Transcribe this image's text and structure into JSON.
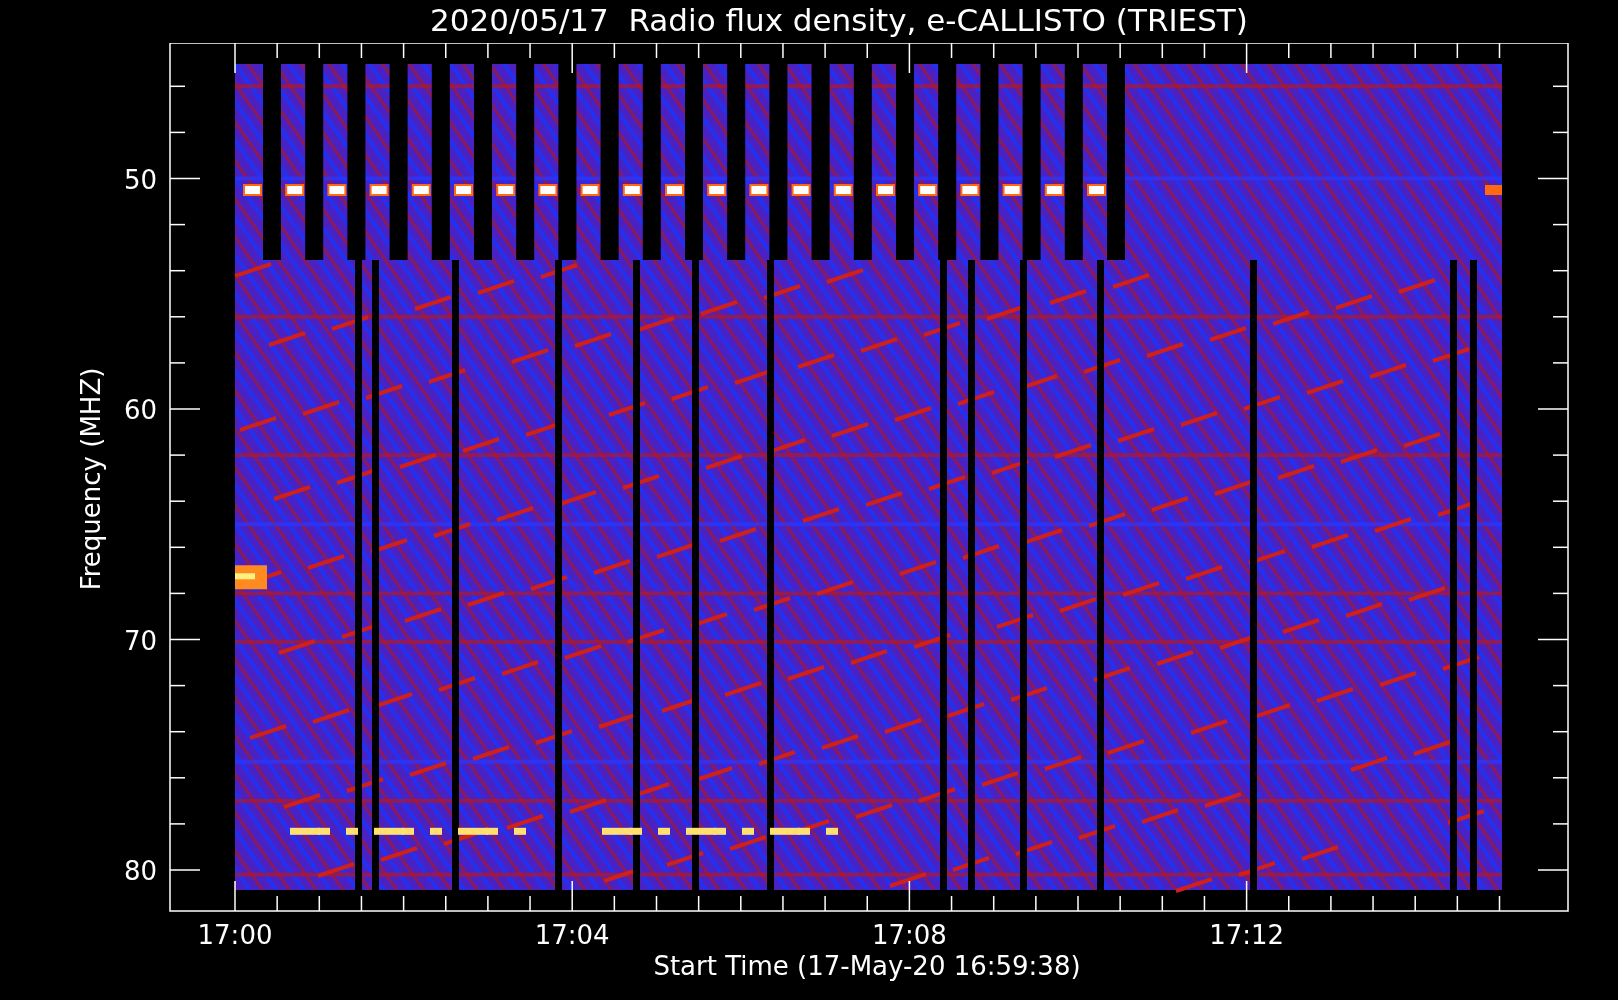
{
  "title": "2020/05/17  Radio flux density, e-CALLISTO (TRIEST)",
  "y_axis": {
    "label": "Frequency (MHZ)",
    "ticks": [
      "50",
      "60",
      "70",
      "80"
    ]
  },
  "x_axis": {
    "label": "Start Time (17-May-20 16:59:38)",
    "ticks": [
      "17:00",
      "17:04",
      "17:08",
      "17:12"
    ]
  }
}
